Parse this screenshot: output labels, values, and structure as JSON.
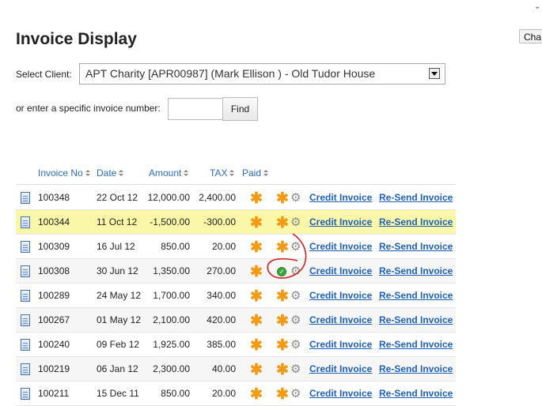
{
  "top_char": "ˇ",
  "header": {
    "cha_button_label": "Cha"
  },
  "page": {
    "title": "Invoice Display"
  },
  "client": {
    "label": "Select Client:",
    "selected": "APT Charity [APR00987] (Mark Ellison ) - Old Tudor House"
  },
  "search": {
    "label": "or enter a specific invoice number:",
    "value": "",
    "find_label": "Find"
  },
  "table": {
    "columns": [
      "Invoice No",
      "Date",
      "Amount",
      "TAX",
      "Paid"
    ],
    "credit_label": "Credit Invoice",
    "resend_label": "Re-Send Invoice",
    "rows": [
      {
        "no": "100348",
        "date": "22 Oct 12",
        "amount": "12,000.00",
        "tax": "2,400.00",
        "status": "pending"
      },
      {
        "no": "100344",
        "date": "11 Oct 12",
        "amount": "-1,500.00",
        "tax": "-300.00",
        "status": "pending"
      },
      {
        "no": "100309",
        "date": "16 Jul 12",
        "amount": "850.00",
        "tax": "20.00",
        "status": "pending"
      },
      {
        "no": "100308",
        "date": "30 Jun 12",
        "amount": "1,350.00",
        "tax": "270.00",
        "status": "paid"
      },
      {
        "no": "100289",
        "date": "24 May 12",
        "amount": "1,700.00",
        "tax": "340.00",
        "status": "pending"
      },
      {
        "no": "100267",
        "date": "01 May 12",
        "amount": "2,100.00",
        "tax": "420.00",
        "status": "pending"
      },
      {
        "no": "100240",
        "date": "09 Feb 12",
        "amount": "1,925.00",
        "tax": "385.00",
        "status": "pending"
      },
      {
        "no": "100219",
        "date": "06 Jan 12",
        "amount": "2,300.00",
        "tax": "40.00",
        "status": "pending"
      },
      {
        "no": "100211",
        "date": "15 Dec 11",
        "amount": "850.00",
        "tax": "20.00",
        "status": "pending"
      }
    ]
  },
  "colors": {
    "link": "#1f60b8",
    "highlight_row": "#fbf7a8",
    "asterisk": "#f29a12",
    "annotation": "#d62020"
  },
  "icons": {
    "doc": "document-icon",
    "status": "asterisk-icon",
    "paid": "check-circle-icon",
    "settings": "gear-icon"
  }
}
